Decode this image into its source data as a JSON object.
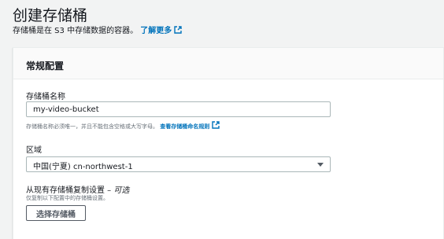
{
  "page": {
    "title": "创建存储桶",
    "description": "存储桶是在 S3 中存储数据的容器。",
    "learn_more": "了解更多"
  },
  "panel": {
    "title": "常规配置",
    "bucket_name": {
      "label": "存储桶名称",
      "value": "my-video-bucket",
      "hint": "存储桶名称必须唯一，并且不能包含空格或大写字母。",
      "hint_link": "查看存储桶命名规则"
    },
    "region": {
      "label": "区域",
      "selected": "中国(宁夏) cn-northwest-1"
    },
    "copy_settings": {
      "label": "从现有存储桶复制设置 – ",
      "optional": "可选",
      "hint": "仅复制以下配置中的存储桶设置。",
      "button": "选择存储桶"
    }
  },
  "colors": {
    "link": "#0073bb",
    "background": "#f2f3f3"
  },
  "icons": [
    "external-link-icon",
    "dropdown-caret-icon"
  ]
}
